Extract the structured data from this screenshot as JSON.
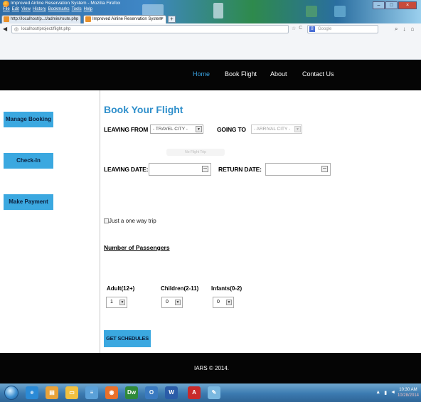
{
  "browser": {
    "window_title": "Improved Airline Reservation System - Mozilla Firefox",
    "menu": [
      "File",
      "Edit",
      "View",
      "History",
      "Bookmarks",
      "Tools",
      "Help"
    ],
    "tabs": [
      {
        "label": "http://localhost/p...t/admin/route.php"
      },
      {
        "label": "Improved Airline Reservation System"
      }
    ],
    "new_tab_label": "+",
    "tab_close": "×",
    "url": "localhost/project/flight.php",
    "search_placeholder": "Google",
    "search_engine_glyph": "8"
  },
  "header": {
    "nav": [
      "Home",
      "Book Flight",
      "About",
      "Contact Us"
    ],
    "active": "Home",
    "accent": "#3aa6e6"
  },
  "sidebar": {
    "items": [
      "Manage Booking",
      "Check-In",
      "Make Payment"
    ],
    "button_color": "#3ba8e0"
  },
  "form": {
    "title": "Book Your Flight",
    "leaving_from_label": "LEAVING FROM",
    "leaving_from_value": "- TRAVEL CITY -",
    "going_to_label": "GOING TO",
    "going_to_value": "- ARRIVAL CITY -",
    "ghost_button_label": "No Flight Trip",
    "leaving_date_label": "LEAVING DATE:",
    "leaving_date_value": "",
    "return_date_label": "RETURN DATE:",
    "return_date_value": "",
    "one_way_label": "Just a one way trip",
    "passengers_heading": "Number of Passengers",
    "adult_label": "Adult(12+)",
    "adult_value": "1",
    "children_label": "Children(2-11)",
    "children_value": "0",
    "infants_label": "Infants(0-2)",
    "infants_value": "0",
    "submit_label": "GET SCHEDULES"
  },
  "footer": {
    "text": "IARS © 2014."
  },
  "taskbar": {
    "apps": [
      "IE",
      "Explorer",
      "Folder",
      "Notepad",
      "Firefox",
      "Dreamweaver",
      "Outlook",
      "Word",
      "Acrobat",
      "Paint"
    ],
    "time": "10:30 AM",
    "date": "10/28/2014"
  }
}
